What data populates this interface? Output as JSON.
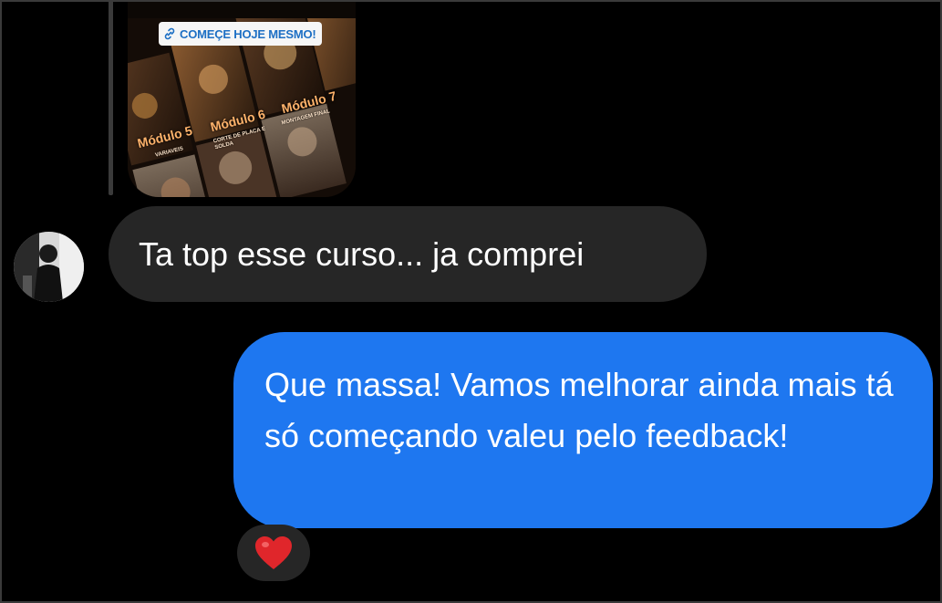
{
  "story": {
    "link_label": "COMEÇE HOJE MESMO!",
    "modules": [
      {
        "title": "Módulo 5",
        "subtitle": "VARIAVEIS"
      },
      {
        "title": "Módulo 6",
        "subtitle": "CORTE DE PLACA E SOLDA"
      },
      {
        "title": "Módulo 7",
        "subtitle": "MONTAGEM FINAL"
      }
    ]
  },
  "messages": {
    "incoming": {
      "text": "Ta top esse curso... ja comprei"
    },
    "outgoing": {
      "text": "Que massa!  Vamos melhorar ainda mais tá só começando valeu pelo feedback!"
    }
  },
  "reaction": {
    "emoji": "❤️",
    "icon": "heart-icon",
    "color": "#e0262b"
  },
  "colors": {
    "incoming_bubble": "#262626",
    "outgoing_bubble": "#1e77f0",
    "background": "#000000"
  }
}
